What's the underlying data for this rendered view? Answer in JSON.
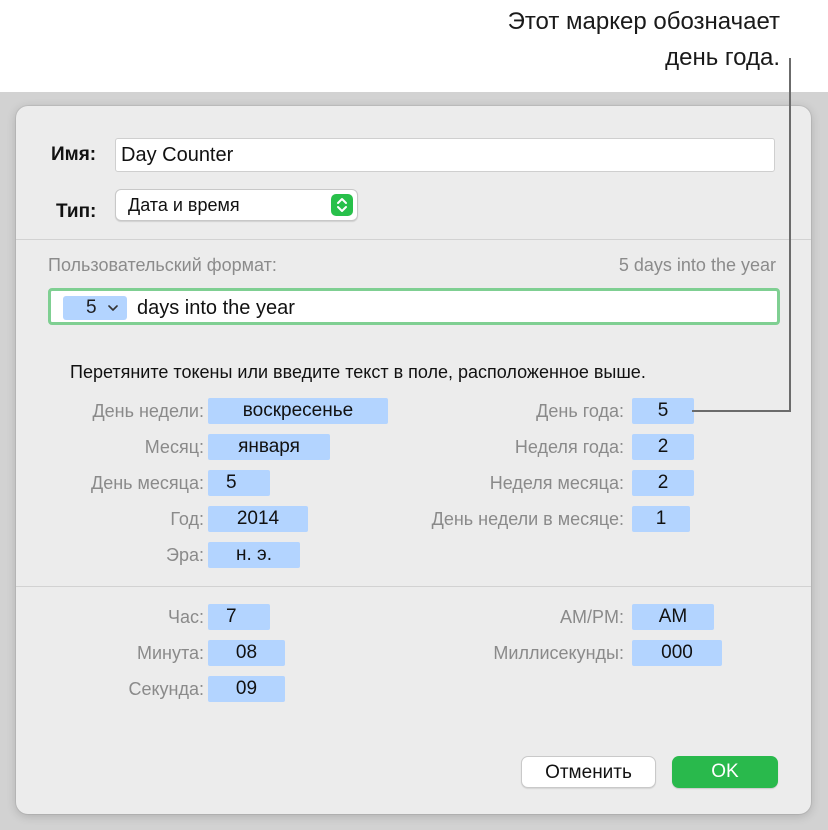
{
  "callout": {
    "line1": "Этот маркер обозначает",
    "line2": "день года."
  },
  "dialog": {
    "name_label": "Имя:",
    "name_value": "Day Counter",
    "type_label": "Тип:",
    "type_value": "Дата и время",
    "custom_format_label": "Пользовательский формат:",
    "preview": "5 days into the year",
    "format_token": "5",
    "format_text": "days into the year",
    "instructions": "Перетяните токены или введите текст в поле, расположенное выше.",
    "date_tokens": {
      "weekday": {
        "label": "День недели:",
        "value": "воскресенье"
      },
      "month": {
        "label": "Месяц:",
        "value": "января"
      },
      "day_of_month": {
        "label": "День месяца:",
        "value": "5"
      },
      "year": {
        "label": "Год:",
        "value": "2014"
      },
      "era": {
        "label": "Эра:",
        "value": "н. э."
      },
      "day_of_year": {
        "label": "День года:",
        "value": "5"
      },
      "week_of_year": {
        "label": "Неделя года:",
        "value": "2"
      },
      "week_of_month": {
        "label": "Неделя месяца:",
        "value": "2"
      },
      "weekday_in_month": {
        "label": "День недели в месяце:",
        "value": "1"
      }
    },
    "time_tokens": {
      "hour": {
        "label": "Час:",
        "value": "7"
      },
      "minute": {
        "label": "Минута:",
        "value": "08"
      },
      "second": {
        "label": "Секунда:",
        "value": "09"
      },
      "ampm": {
        "label": "AM/PM:",
        "value": "AM"
      },
      "milliseconds": {
        "label": "Миллисекунды:",
        "value": "000"
      }
    },
    "cancel_label": "Отменить",
    "ok_label": "OK"
  },
  "colors": {
    "token_bg": "#b3d4ff",
    "accent_green": "#29b94c",
    "focus_ring": "#7fcf92"
  }
}
